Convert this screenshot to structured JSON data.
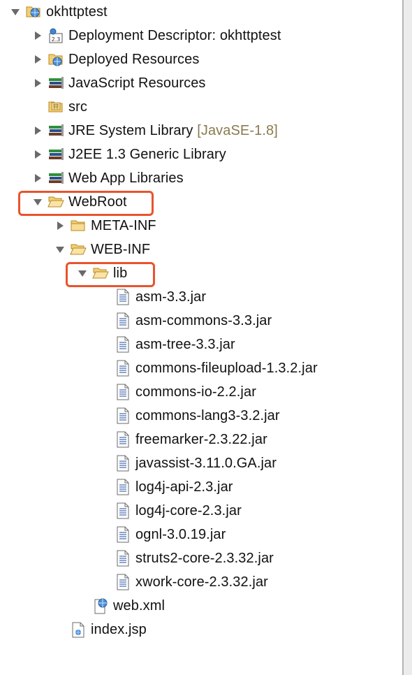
{
  "tree": {
    "project": {
      "label": "okhttptest",
      "icon": "web-project-icon",
      "expanded": true
    },
    "items": [
      {
        "label": "Deployment Descriptor: okhttptest",
        "icon": "deployment-descriptor-icon",
        "expanded": false
      },
      {
        "label": "Deployed Resources",
        "icon": "deployed-resources-icon",
        "expanded": false
      },
      {
        "label": "JavaScript Resources",
        "icon": "library-icon",
        "expanded": false
      },
      {
        "label": "src",
        "icon": "source-folder-icon"
      },
      {
        "label": "JRE System Library",
        "decoration": "[JavaSE-1.8]",
        "icon": "library-icon",
        "expanded": false
      },
      {
        "label": "J2EE 1.3 Generic Library",
        "icon": "library-icon",
        "expanded": false
      },
      {
        "label": "Web App Libraries",
        "icon": "library-icon",
        "expanded": false
      }
    ],
    "webroot": {
      "label": "WebRoot",
      "icon": "folder-open-icon",
      "expanded": true
    },
    "meta_inf": {
      "label": "META-INF",
      "icon": "folder-icon",
      "expanded": false
    },
    "web_inf": {
      "label": "WEB-INF",
      "icon": "folder-open-icon",
      "expanded": true
    },
    "lib": {
      "label": "lib",
      "icon": "folder-open-icon",
      "expanded": true
    },
    "jars": [
      "asm-3.3.jar",
      "asm-commons-3.3.jar",
      "asm-tree-3.3.jar",
      "commons-fileupload-1.3.2.jar",
      "commons-io-2.2.jar",
      "commons-lang3-3.2.jar",
      "freemarker-2.3.22.jar",
      "javassist-3.11.0.GA.jar",
      "log4j-api-2.3.jar",
      "log4j-core-2.3.jar",
      "ognl-3.0.19.jar",
      "struts2-core-2.3.32.jar",
      "xwork-core-2.3.32.jar"
    ],
    "web_xml": {
      "label": "web.xml",
      "icon": "xml-file-icon"
    },
    "index_jsp": {
      "label": "index.jsp",
      "icon": "jsp-file-icon"
    }
  },
  "colors": {
    "highlight": "#e8542d",
    "folder": "#e9b84c",
    "library_green": "#2f8f3a",
    "library_blue": "#2b4f8c",
    "decoration": "#8a7a4e"
  }
}
